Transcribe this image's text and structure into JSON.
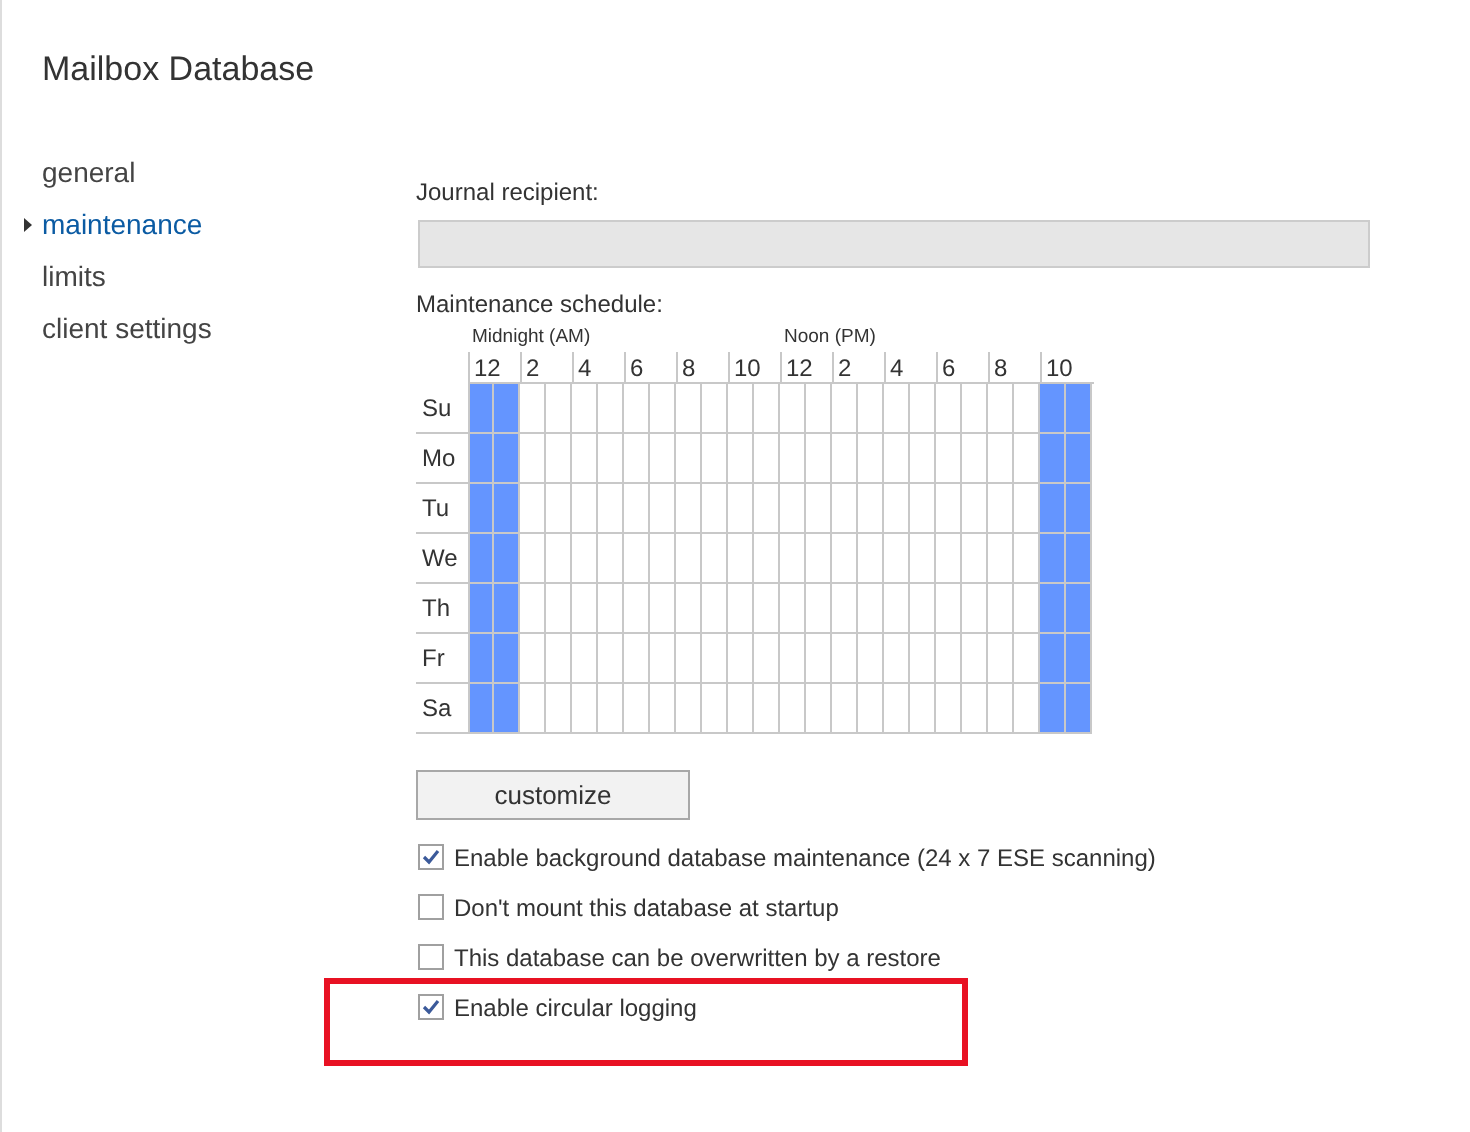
{
  "title": "Mailbox Database",
  "nav": [
    {
      "label": "general",
      "selected": false
    },
    {
      "label": "maintenance",
      "selected": true
    },
    {
      "label": "limits",
      "selected": false
    },
    {
      "label": "client settings",
      "selected": false
    }
  ],
  "journal_recipient": {
    "label": "Journal recipient:",
    "disabled": true
  },
  "schedule": {
    "label": "Maintenance schedule:",
    "am_label": "Midnight (AM)",
    "pm_label": "Noon (PM)",
    "hour_labels": [
      "12",
      "2",
      "4",
      "6",
      "8",
      "10",
      "12",
      "2",
      "4",
      "6",
      "8",
      "10"
    ],
    "rows": [
      {
        "day": "Su",
        "hours": [
          true,
          true,
          false,
          false,
          false,
          false,
          false,
          false,
          false,
          false,
          false,
          false,
          false,
          false,
          false,
          false,
          false,
          false,
          false,
          false,
          false,
          false,
          true,
          true
        ]
      },
      {
        "day": "Mo",
        "hours": [
          true,
          true,
          false,
          false,
          false,
          false,
          false,
          false,
          false,
          false,
          false,
          false,
          false,
          false,
          false,
          false,
          false,
          false,
          false,
          false,
          false,
          false,
          true,
          true
        ]
      },
      {
        "day": "Tu",
        "hours": [
          true,
          true,
          false,
          false,
          false,
          false,
          false,
          false,
          false,
          false,
          false,
          false,
          false,
          false,
          false,
          false,
          false,
          false,
          false,
          false,
          false,
          false,
          true,
          true
        ]
      },
      {
        "day": "We",
        "hours": [
          true,
          true,
          false,
          false,
          false,
          false,
          false,
          false,
          false,
          false,
          false,
          false,
          false,
          false,
          false,
          false,
          false,
          false,
          false,
          false,
          false,
          false,
          true,
          true
        ]
      },
      {
        "day": "Th",
        "hours": [
          true,
          true,
          false,
          false,
          false,
          false,
          false,
          false,
          false,
          false,
          false,
          false,
          false,
          false,
          false,
          false,
          false,
          false,
          false,
          false,
          false,
          false,
          true,
          true
        ]
      },
      {
        "day": "Fr",
        "hours": [
          true,
          true,
          false,
          false,
          false,
          false,
          false,
          false,
          false,
          false,
          false,
          false,
          false,
          false,
          false,
          false,
          false,
          false,
          false,
          false,
          false,
          false,
          true,
          true
        ]
      },
      {
        "day": "Sa",
        "hours": [
          true,
          true,
          false,
          false,
          false,
          false,
          false,
          false,
          false,
          false,
          false,
          false,
          false,
          false,
          false,
          false,
          false,
          false,
          false,
          false,
          false,
          false,
          true,
          true
        ]
      }
    ],
    "button": "customize"
  },
  "options": [
    {
      "label": "Enable background database maintenance (24 x 7 ESE scanning)",
      "checked": true,
      "highlighted": false
    },
    {
      "label": "Don't mount this database at startup",
      "checked": false,
      "highlighted": false
    },
    {
      "label": "This database can be overwritten by a restore",
      "checked": false,
      "highlighted": false
    },
    {
      "label": "Enable circular logging",
      "checked": true,
      "highlighted": true
    }
  ]
}
